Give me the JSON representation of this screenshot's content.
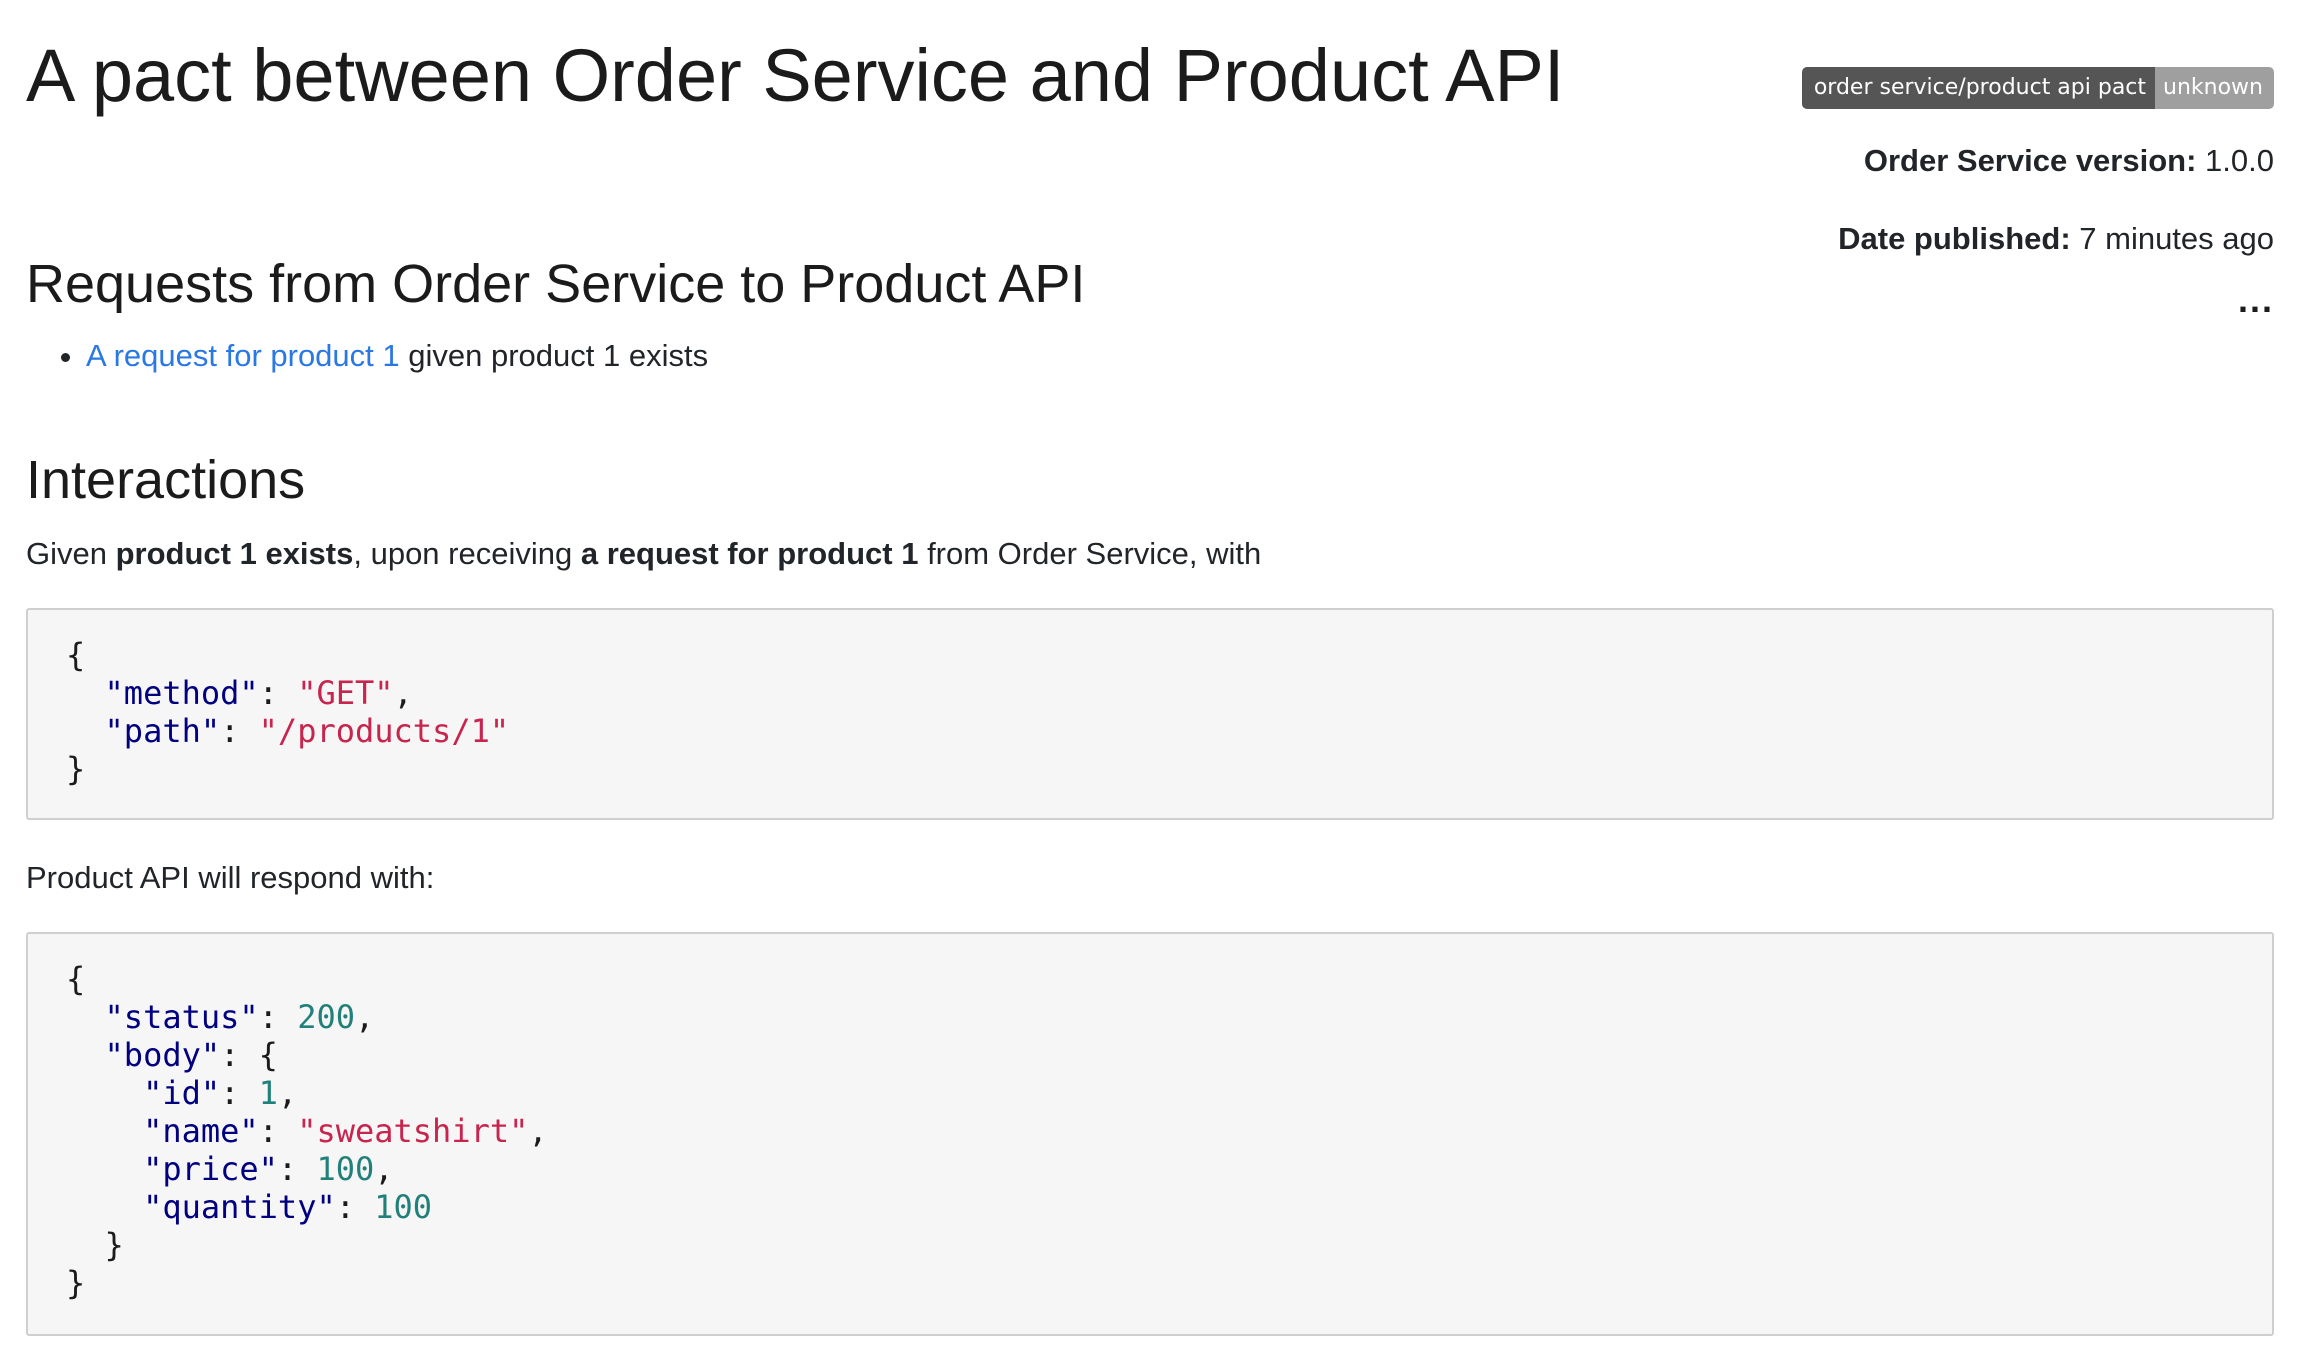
{
  "header": {
    "title": "A pact between Order Service and Product API"
  },
  "badge": {
    "label": "order service/product api pact",
    "status": "unknown",
    "label_color": "#555555",
    "status_color": "#9f9f9f"
  },
  "meta": {
    "version_label": "Order Service version:",
    "version_value": "1.0.0",
    "date_label": "Date published:",
    "date_value": "7 minutes ago",
    "more_menu": "..."
  },
  "requests_section": {
    "heading": "Requests from Order Service to Product API",
    "items": [
      {
        "link_text": "A request for product 1",
        "suffix": " given product 1 exists"
      }
    ]
  },
  "interactions": {
    "heading": "Interactions",
    "given_prefix": "Given ",
    "given_state": "product 1 exists",
    "upon_text": ", upon receiving ",
    "description": "a request for product 1",
    "from_text": " from Order Service, with",
    "request": {
      "open": "{",
      "close": "}",
      "method_key": "\"method\"",
      "method_value": "\"GET\"",
      "path_key": "\"path\"",
      "path_value": "\"/products/1\""
    },
    "respond_text": "Product API will respond with:",
    "response": {
      "open": "{",
      "close": "}",
      "status_key": "\"status\"",
      "status_value": "200",
      "body_key": "\"body\"",
      "body_open": "{",
      "body_close": "}",
      "id_key": "\"id\"",
      "id_value": "1",
      "name_key": "\"name\"",
      "name_value": "\"sweatshirt\"",
      "price_key": "\"price\"",
      "price_value": "100",
      "quantity_key": "\"quantity\"",
      "quantity_value": "100"
    }
  },
  "colors": {
    "link": "#2a78e4",
    "json_key": "#000080",
    "json_string": "#c7254e",
    "json_number": "#21807a",
    "code_background": "#f6f6f6"
  }
}
